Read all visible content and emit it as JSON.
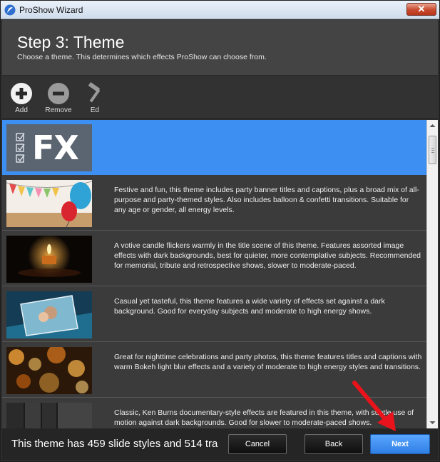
{
  "window": {
    "title": "ProShow Wizard",
    "close_label": "✕"
  },
  "header": {
    "title": "Step 3: Theme",
    "subtitle": "Choose a theme. This determines which effects ProShow can choose from."
  },
  "toolbar": {
    "items": [
      {
        "label": "Add",
        "icon": "add-icon"
      },
      {
        "label": "Remove",
        "icon": "remove-icon"
      },
      {
        "label": "Ed",
        "icon": "hammer-icon"
      }
    ]
  },
  "themes": [
    {
      "thumb_text": "FX",
      "description": ""
    },
    {
      "description": "Festive and fun, this theme includes party banner titles and captions, plus a broad mix of all-purpose and party-themed styles. Also includes balloon & confetti transitions. Suitable for any age or gender, all energy levels."
    },
    {
      "description": "A votive candle flickers warmly in the title scene of this theme. Features assorted image effects with dark backgrounds, best for quieter, more contemplative subjects. Recommended for memorial, tribute and retrospective shows, slower to moderate-paced."
    },
    {
      "description": "Casual yet tasteful, this theme features a wide variety of effects set against a dark background. Good for everyday subjects and moderate to high energy shows."
    },
    {
      "description": "Great for nighttime celebrations and party photos, this theme features titles and captions with warm Bokeh light blur effects and a variety of moderate to high energy styles and transitions."
    },
    {
      "description": "Classic, Ken Burns documentary-style effects are featured in this theme, with subtle use of motion against dark backgrounds. Good for slower to moderate-paced shows."
    }
  ],
  "footer": {
    "status": "This theme has 459 slide styles and 514 tra",
    "cancel_label": "Cancel",
    "back_label": "Back",
    "next_label": "Next"
  },
  "colors": {
    "selected": "#3d8ff2",
    "primary_button": "#2f7fe4",
    "annotation_arrow": "#e8131b"
  }
}
